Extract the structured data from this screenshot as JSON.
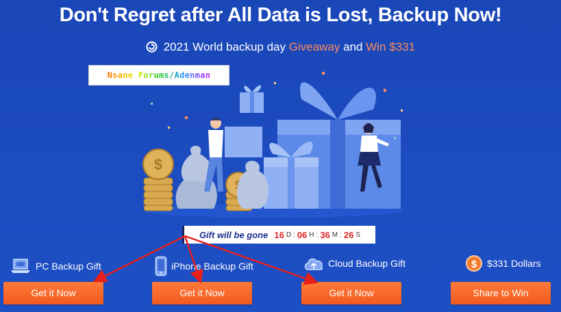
{
  "header": {
    "title": "Don't Regret after All Data is Lost, Backup Now!",
    "subtitle_prefix": "2021 World backup day",
    "subtitle_highlight1": "Giveaway",
    "subtitle_and": "and",
    "subtitle_highlight2": "Win $331",
    "icon": "refresh-icon"
  },
  "watermark": "Nsane Forums/Adenman",
  "countdown": {
    "label": "Gift will be gone",
    "days": "16",
    "days_unit": "D",
    "hours": "06",
    "hours_unit": "H",
    "minutes": "36",
    "minutes_unit": "M",
    "seconds": "26",
    "seconds_unit": "S"
  },
  "gifts": [
    {
      "label": "PC Backup Gift",
      "button": "Get it Now",
      "icon": "laptop-icon"
    },
    {
      "label": "iPhone Backup Gift",
      "button": "Get it Now",
      "icon": "phone-icon"
    },
    {
      "label": "Cloud Backup Gift",
      "button": "Get it Now",
      "icon": "cloud-icon"
    },
    {
      "label": "$331 Dollars",
      "button": "Share to Win",
      "icon": "dollar-coin-icon"
    }
  ],
  "colors": {
    "background": "#1c4cc0",
    "highlight": "#ff8a5c",
    "button": "#f25a1e",
    "arrow": "#e8201a",
    "countdown_numbers": "#e02525"
  }
}
